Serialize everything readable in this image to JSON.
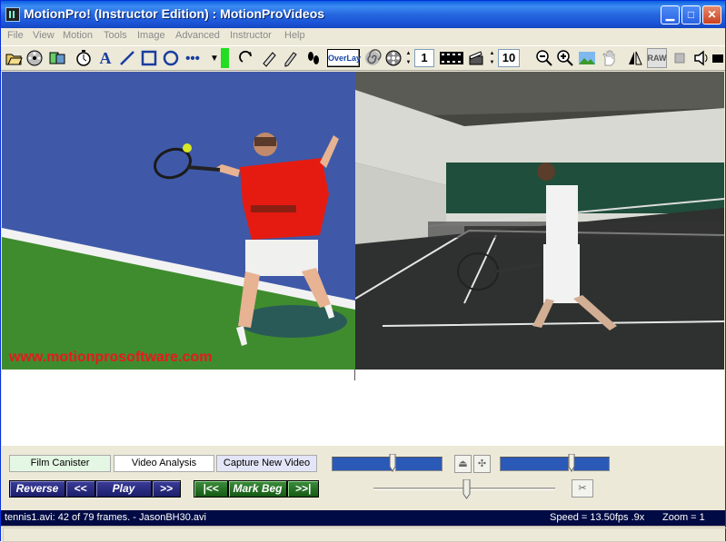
{
  "window": {
    "title": "MotionPro! (Instructor Edition) : MotionProVideos"
  },
  "menu": [
    "File",
    "View",
    "Motion",
    "Tools",
    "Image",
    "Advanced",
    "Instructor",
    "Help"
  ],
  "toolbar": {
    "overlay_label": "OverLay",
    "frame_step": "1",
    "frame_count": "10",
    "raw_label": "RAW",
    "draw_color": "#22dd22"
  },
  "video": {
    "watermark": "www.motionprosoftware.com"
  },
  "tabs": [
    {
      "label": "Film Canister",
      "active": false
    },
    {
      "label": "Video Analysis",
      "active": true
    },
    {
      "label": "Capture New Video",
      "active": false
    }
  ],
  "controls": {
    "reverse": "Reverse",
    "rewind": "<<",
    "play": "Play",
    "forward": ">>",
    "first": "|<<",
    "mark_beg": "Mark Beg",
    "last": ">>|"
  },
  "status": {
    "file_info": "tennis1.avi:  42 of 79 frames.  - JasonBH30.avi",
    "speed": "Speed = 13.50fps  .9x",
    "zoom": "Zoom =  1",
    "current_frame": 42,
    "total_frames": 79
  },
  "colors": {
    "title_bar": "#1b55d6",
    "status_bar": "#000a44",
    "slider": "#2a59b8"
  }
}
